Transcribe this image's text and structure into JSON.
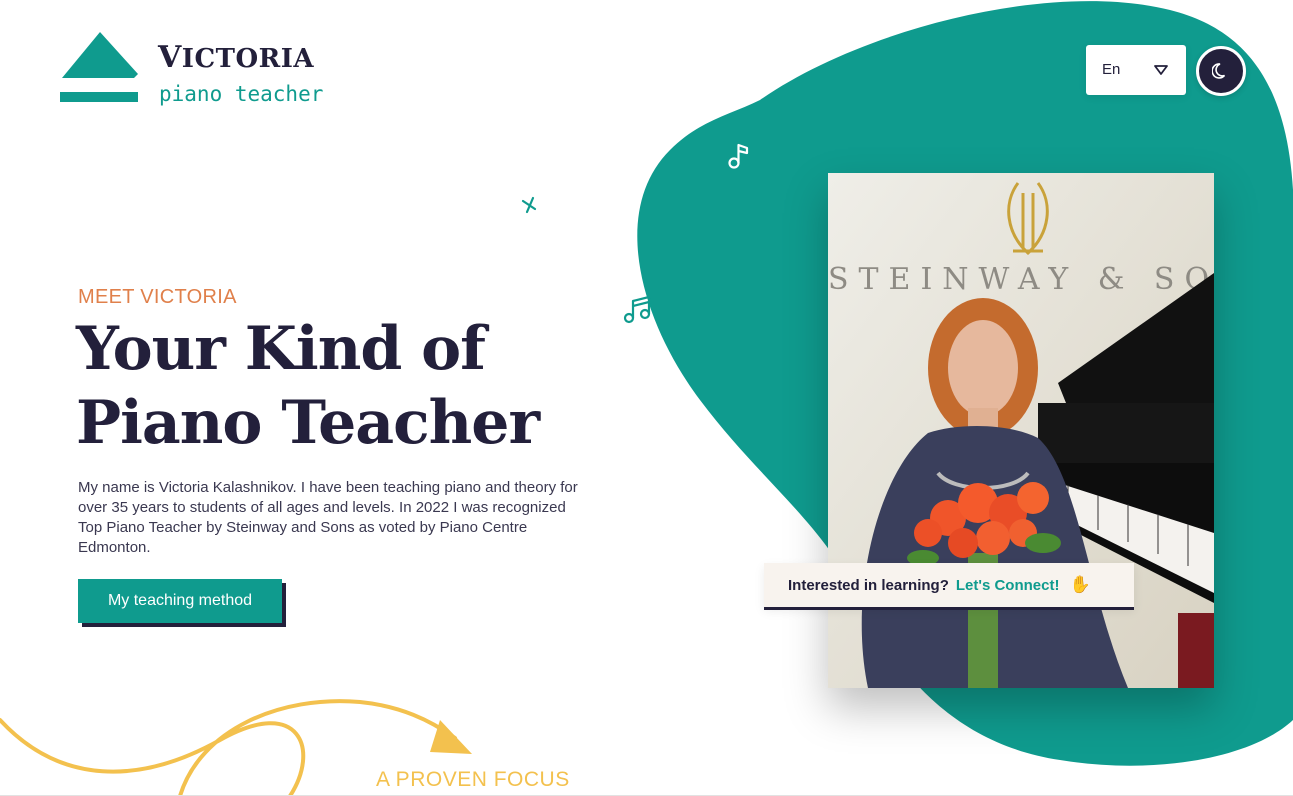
{
  "brand": {
    "name_initial": "V",
    "name_rest": "ICTORIA",
    "subtitle": "piano teacher"
  },
  "header": {
    "language_value": "En",
    "theme_toggle_icon": "moon-icon"
  },
  "hero": {
    "eyebrow": "MEET VICTORIA",
    "headline_line1": "Your Kind of",
    "headline_line2": "Piano Teacher",
    "intro": "My name is Victoria Kalashnikov. I have been teaching piano and theory for over 35 years to students of all ages and levels. In 2022 I was recognized Top Piano Teacher by Steinway and Sons as voted by Piano Centre Edmonton.",
    "cta_label": "My teaching method"
  },
  "photo": {
    "wall_text": "STEINWAY & SONS"
  },
  "connect": {
    "label": "Interested in learning?",
    "link": "Let's Connect!",
    "icon": "waving-hand-icon"
  },
  "next_section": {
    "label": "A PROVEN FOCUS"
  },
  "colors": {
    "teal": "#0f9b8e",
    "navy": "#23203b",
    "orange": "#e0804b",
    "yellow": "#f3c14e"
  }
}
